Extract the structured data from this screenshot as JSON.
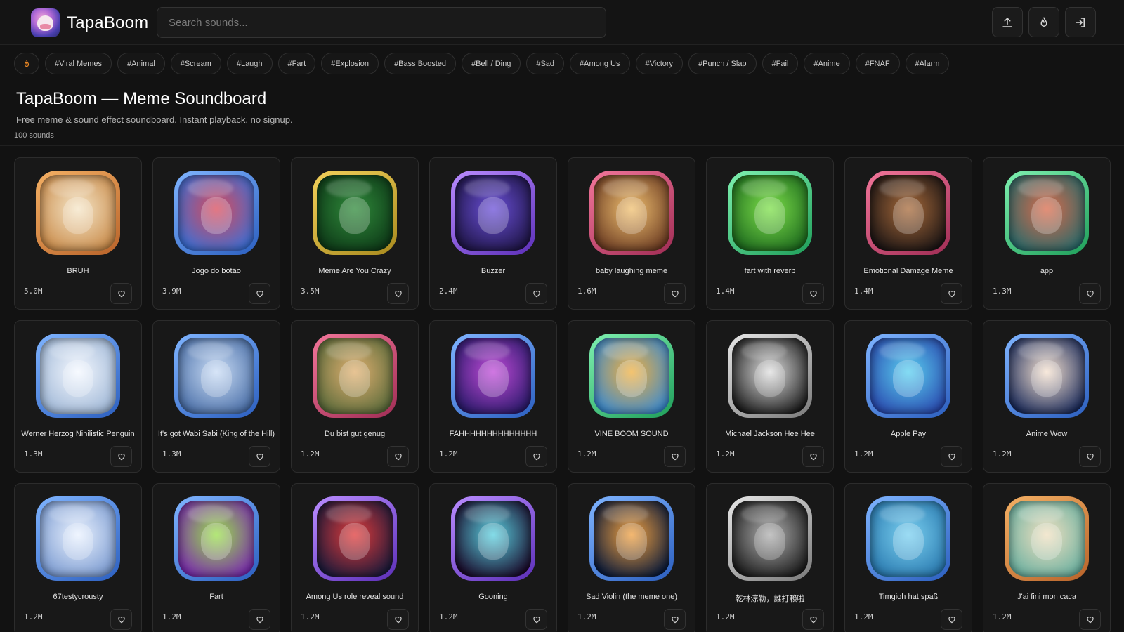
{
  "header": {
    "brand": "TapaBoom",
    "search_placeholder": "Search sounds...",
    "buttons": [
      {
        "icon": "upload-icon"
      },
      {
        "icon": "flame-icon"
      },
      {
        "icon": "login-icon"
      }
    ]
  },
  "tags": [
    "#Viral Memes",
    "#Animal",
    "#Scream",
    "#Laugh",
    "#Fart",
    "#Explosion",
    "#Bass Boosted",
    "#Bell / Ding",
    "#Sad",
    "#Among Us",
    "#Victory",
    "#Punch / Slap",
    "#Fail",
    "#Anime",
    "#FNAF",
    "#Alarm"
  ],
  "page": {
    "title": "TapaBoom — Meme Soundboard",
    "subtitle": "Free meme & sound effect soundboard. Instant playback, no signup.",
    "count": "100 sounds"
  },
  "colors": {
    "background": "#121212",
    "card": "#181818",
    "accent_fire": "#f08a24"
  },
  "sounds": [
    {
      "name": "BRUH",
      "plays": "5.0M",
      "border": "orange",
      "art": [
        "#f5e6c8",
        "#c98b4a"
      ]
    },
    {
      "name": "Jogo do botão",
      "plays": "3.9M",
      "border": "blue",
      "art": [
        "#d94a5a",
        "#3b6fd6"
      ]
    },
    {
      "name": "Meme Are You Crazy",
      "plays": "3.5M",
      "border": "yellow",
      "art": [
        "#2f8a3a",
        "#0e3a18"
      ]
    },
    {
      "name": "Buzzer",
      "plays": "2.4M",
      "border": "purple",
      "art": [
        "#6a4fd8",
        "#1e1545"
      ]
    },
    {
      "name": "baby laughing meme",
      "plays": "1.6M",
      "border": "pink",
      "art": [
        "#f0c070",
        "#6b3b22"
      ]
    },
    {
      "name": "fart with reverb",
      "plays": "1.4M",
      "border": "green",
      "art": [
        "#7ee04a",
        "#1d6a1e"
      ]
    },
    {
      "name": "Emotional Damage Meme",
      "plays": "1.4M",
      "border": "pink",
      "art": [
        "#a86a3a",
        "#1a1414"
      ]
    },
    {
      "name": "app",
      "plays": "1.3M",
      "border": "green",
      "art": [
        "#d96a4a",
        "#2a6a6a"
      ]
    },
    {
      "name": "Werner Herzog Nihilistic Penguin",
      "plays": "1.3M",
      "border": "blue",
      "art": [
        "#f4f8ff",
        "#9fb7d6"
      ]
    },
    {
      "name": "It's got Wabi Sabi (King of the Hill)",
      "plays": "1.3M",
      "border": "blue",
      "art": [
        "#c9dcf5",
        "#4a6fa8"
      ]
    },
    {
      "name": "Du bist gut genug",
      "plays": "1.2M",
      "border": "pink",
      "art": [
        "#e0b070",
        "#5a6a3a"
      ]
    },
    {
      "name": "FAHHHHHHHHHHHHHH",
      "plays": "1.2M",
      "border": "blue",
      "art": [
        "#c04ad8",
        "#2a1a6a"
      ]
    },
    {
      "name": "VINE BOOM SOUND",
      "plays": "1.2M",
      "border": "green",
      "art": [
        "#f0b040",
        "#3a8ad0"
      ]
    },
    {
      "name": "Michael Jackson Hee Hee",
      "plays": "1.2M",
      "border": "silver",
      "art": [
        "#e0e0e0",
        "#1a1a1a"
      ]
    },
    {
      "name": "Apple Pay",
      "plays": "1.2M",
      "border": "blue",
      "art": [
        "#5ad0f0",
        "#2a4ab0"
      ]
    },
    {
      "name": "Anime Wow",
      "plays": "1.2M",
      "border": "blue",
      "art": [
        "#f6e2d0",
        "#1a2a5a"
      ]
    },
    {
      "name": "67testycrousty",
      "plays": "1.2M",
      "border": "blue",
      "art": [
        "#eaf2ff",
        "#7a9ad0"
      ]
    },
    {
      "name": "Fart",
      "plays": "1.2M",
      "border": "blue",
      "art": [
        "#9ae04a",
        "#7a2ab0"
      ]
    },
    {
      "name": "Among Us role reveal sound",
      "plays": "1.2M",
      "border": "purple",
      "art": [
        "#e03a3a",
        "#1a1a3a"
      ]
    },
    {
      "name": "Gooning",
      "plays": "1.2M",
      "border": "purple",
      "art": [
        "#5ad0e0",
        "#1a0a2a"
      ]
    },
    {
      "name": "Sad Violin (the meme one)",
      "plays": "1.2M",
      "border": "blue",
      "art": [
        "#f0a040",
        "#0a1a3a"
      ]
    },
    {
      "name": "乾林涼勒，誰打賴啦",
      "plays": "1.2M",
      "border": "silver",
      "art": [
        "#b0b0b0",
        "#1a1a1a"
      ]
    },
    {
      "name": "Timgioh hat spaß",
      "plays": "1.2M",
      "border": "blue",
      "art": [
        "#7ad0f0",
        "#2a7ab0"
      ]
    },
    {
      "name": "J'ai fini mon caca",
      "plays": "1.2M",
      "border": "orange",
      "art": [
        "#f0e0c0",
        "#6ab0a0"
      ]
    }
  ]
}
